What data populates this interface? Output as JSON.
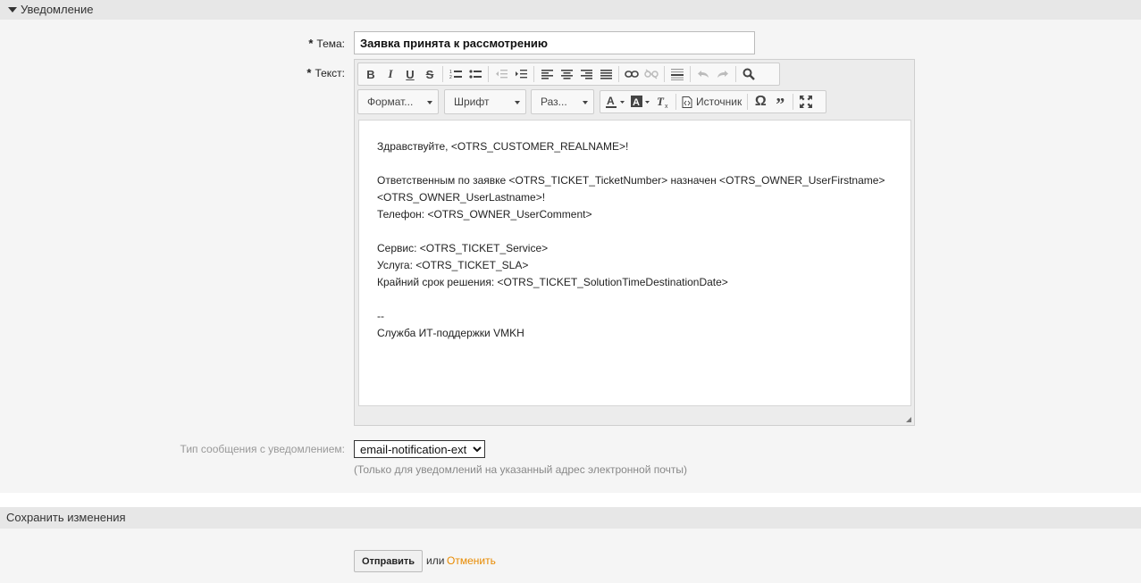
{
  "notification_section": {
    "title": "Уведомление",
    "subject_label": "Тема:",
    "subject_value": "Заявка принята к рассмотрению",
    "text_label": "Текст:",
    "required_mark": "*"
  },
  "editor": {
    "format_combo": "Формат...",
    "font_combo": "Шрифт",
    "size_combo": "Раз...",
    "source_label": "Источник",
    "body_lines": [
      "Здравствуйте, <OTRS_CUSTOMER_REALNAME>!",
      "",
      "Ответственным по заявке <OTRS_TICKET_TicketNumber> назначен <OTRS_OWNER_UserFirstname>",
      "<OTRS_OWNER_UserLastname>!",
      "Телефон: <OTRS_OWNER_UserComment>",
      "",
      "Сервис: <OTRS_TICKET_Service>",
      "Услуга: <OTRS_TICKET_SLA>",
      "Крайний срок решения: <OTRS_TICKET_SolutionTimeDestinationDate>",
      "",
      "--",
      "Служба ИТ-поддержки VMKH"
    ]
  },
  "message_type": {
    "label": "Тип сообщения с уведомлением:",
    "selected": "email-notification-ext",
    "hint": "(Только для уведомлений на указанный адрес электронной почты)"
  },
  "save_section": {
    "title": "Сохранить изменения",
    "submit_label": "Отправить",
    "or_text": "или",
    "cancel_label": "Отменить"
  },
  "colors": {
    "cancel_link": "#e88a00",
    "section_header_bg": "#e7e7e7",
    "panel_bg": "#f5f5f5"
  }
}
